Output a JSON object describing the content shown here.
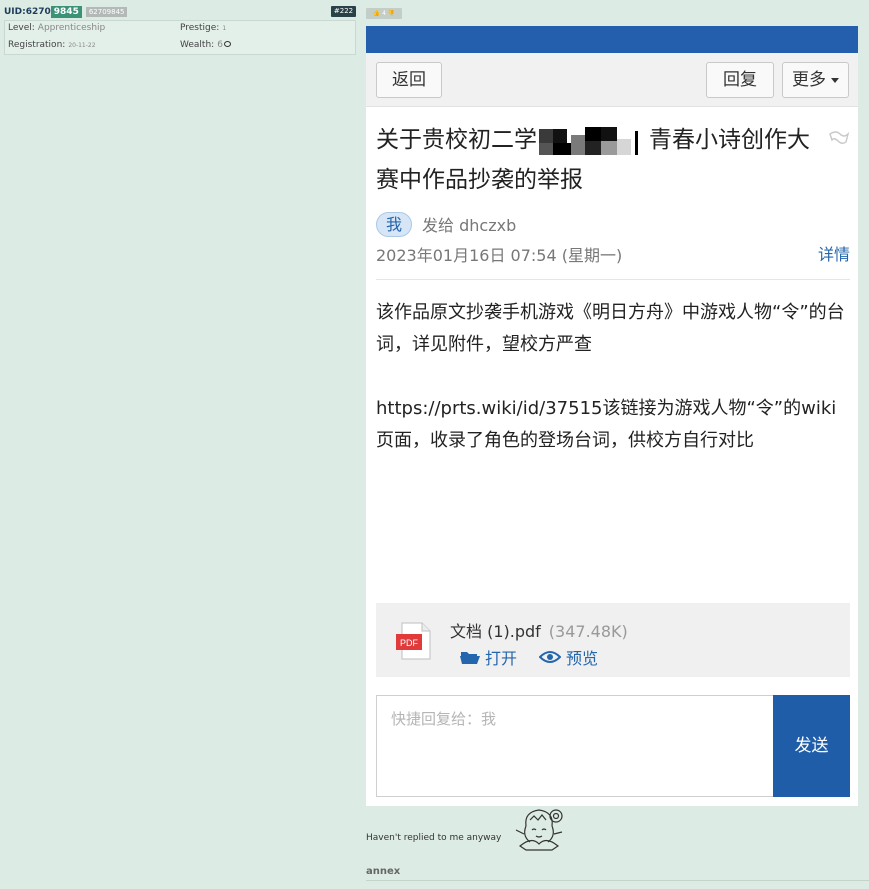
{
  "user": {
    "uid_prefix": "UID:6270",
    "uid_highlight": "9845",
    "uid_full": "62709845",
    "post_number": "#222",
    "level_label": "Level:",
    "level_value": "Apprenticeship",
    "prestige_label": "Prestige:",
    "prestige_value": "1",
    "registration_label": "Registration:",
    "registration_value": "20-11-22",
    "wealth_label": "Wealth:",
    "wealth_value": "6"
  },
  "vote_chip": "👍 4 👎",
  "screenshot": {
    "topbar_ghost": "",
    "toolbar": {
      "back_label": "返回",
      "reply_label": "回复",
      "more_label": "更多"
    },
    "subject_part1": "关于贵校初二学",
    "subject_part2": "青春小诗创作大赛中作品抄袭的举报",
    "me_chip": "我",
    "sent_to": "发给 dhczxb",
    "date": "2023年01月16日 07:54 (星期一)",
    "detail_link": "详情",
    "body_paragraphs": [
      "该作品原文抄袭手机游戏《明日方舟》中游戏人物“令”的台词，详见附件，望校方严查",
      "https://prts.wiki/id/37515该链接为游戏人物“令”的wiki页面，收录了角色的登场台词，供校方自行对比"
    ],
    "attachment": {
      "name": "文档 (1).pdf",
      "size": "(347.48K)",
      "open_label": "打开",
      "preview_label": "预览",
      "icon_text": "PDF"
    },
    "reply_placeholder": "快捷回复给：我",
    "send_label": "发送"
  },
  "comment_text": "Haven't replied to me anyway",
  "annex_label": "annex",
  "colors": {
    "page_bg": "#dcebe3",
    "uid_highlight": "#3b9277",
    "topbar_blue": "#245fae",
    "send_blue": "#1f5da8",
    "link_blue": "#2466ad"
  }
}
